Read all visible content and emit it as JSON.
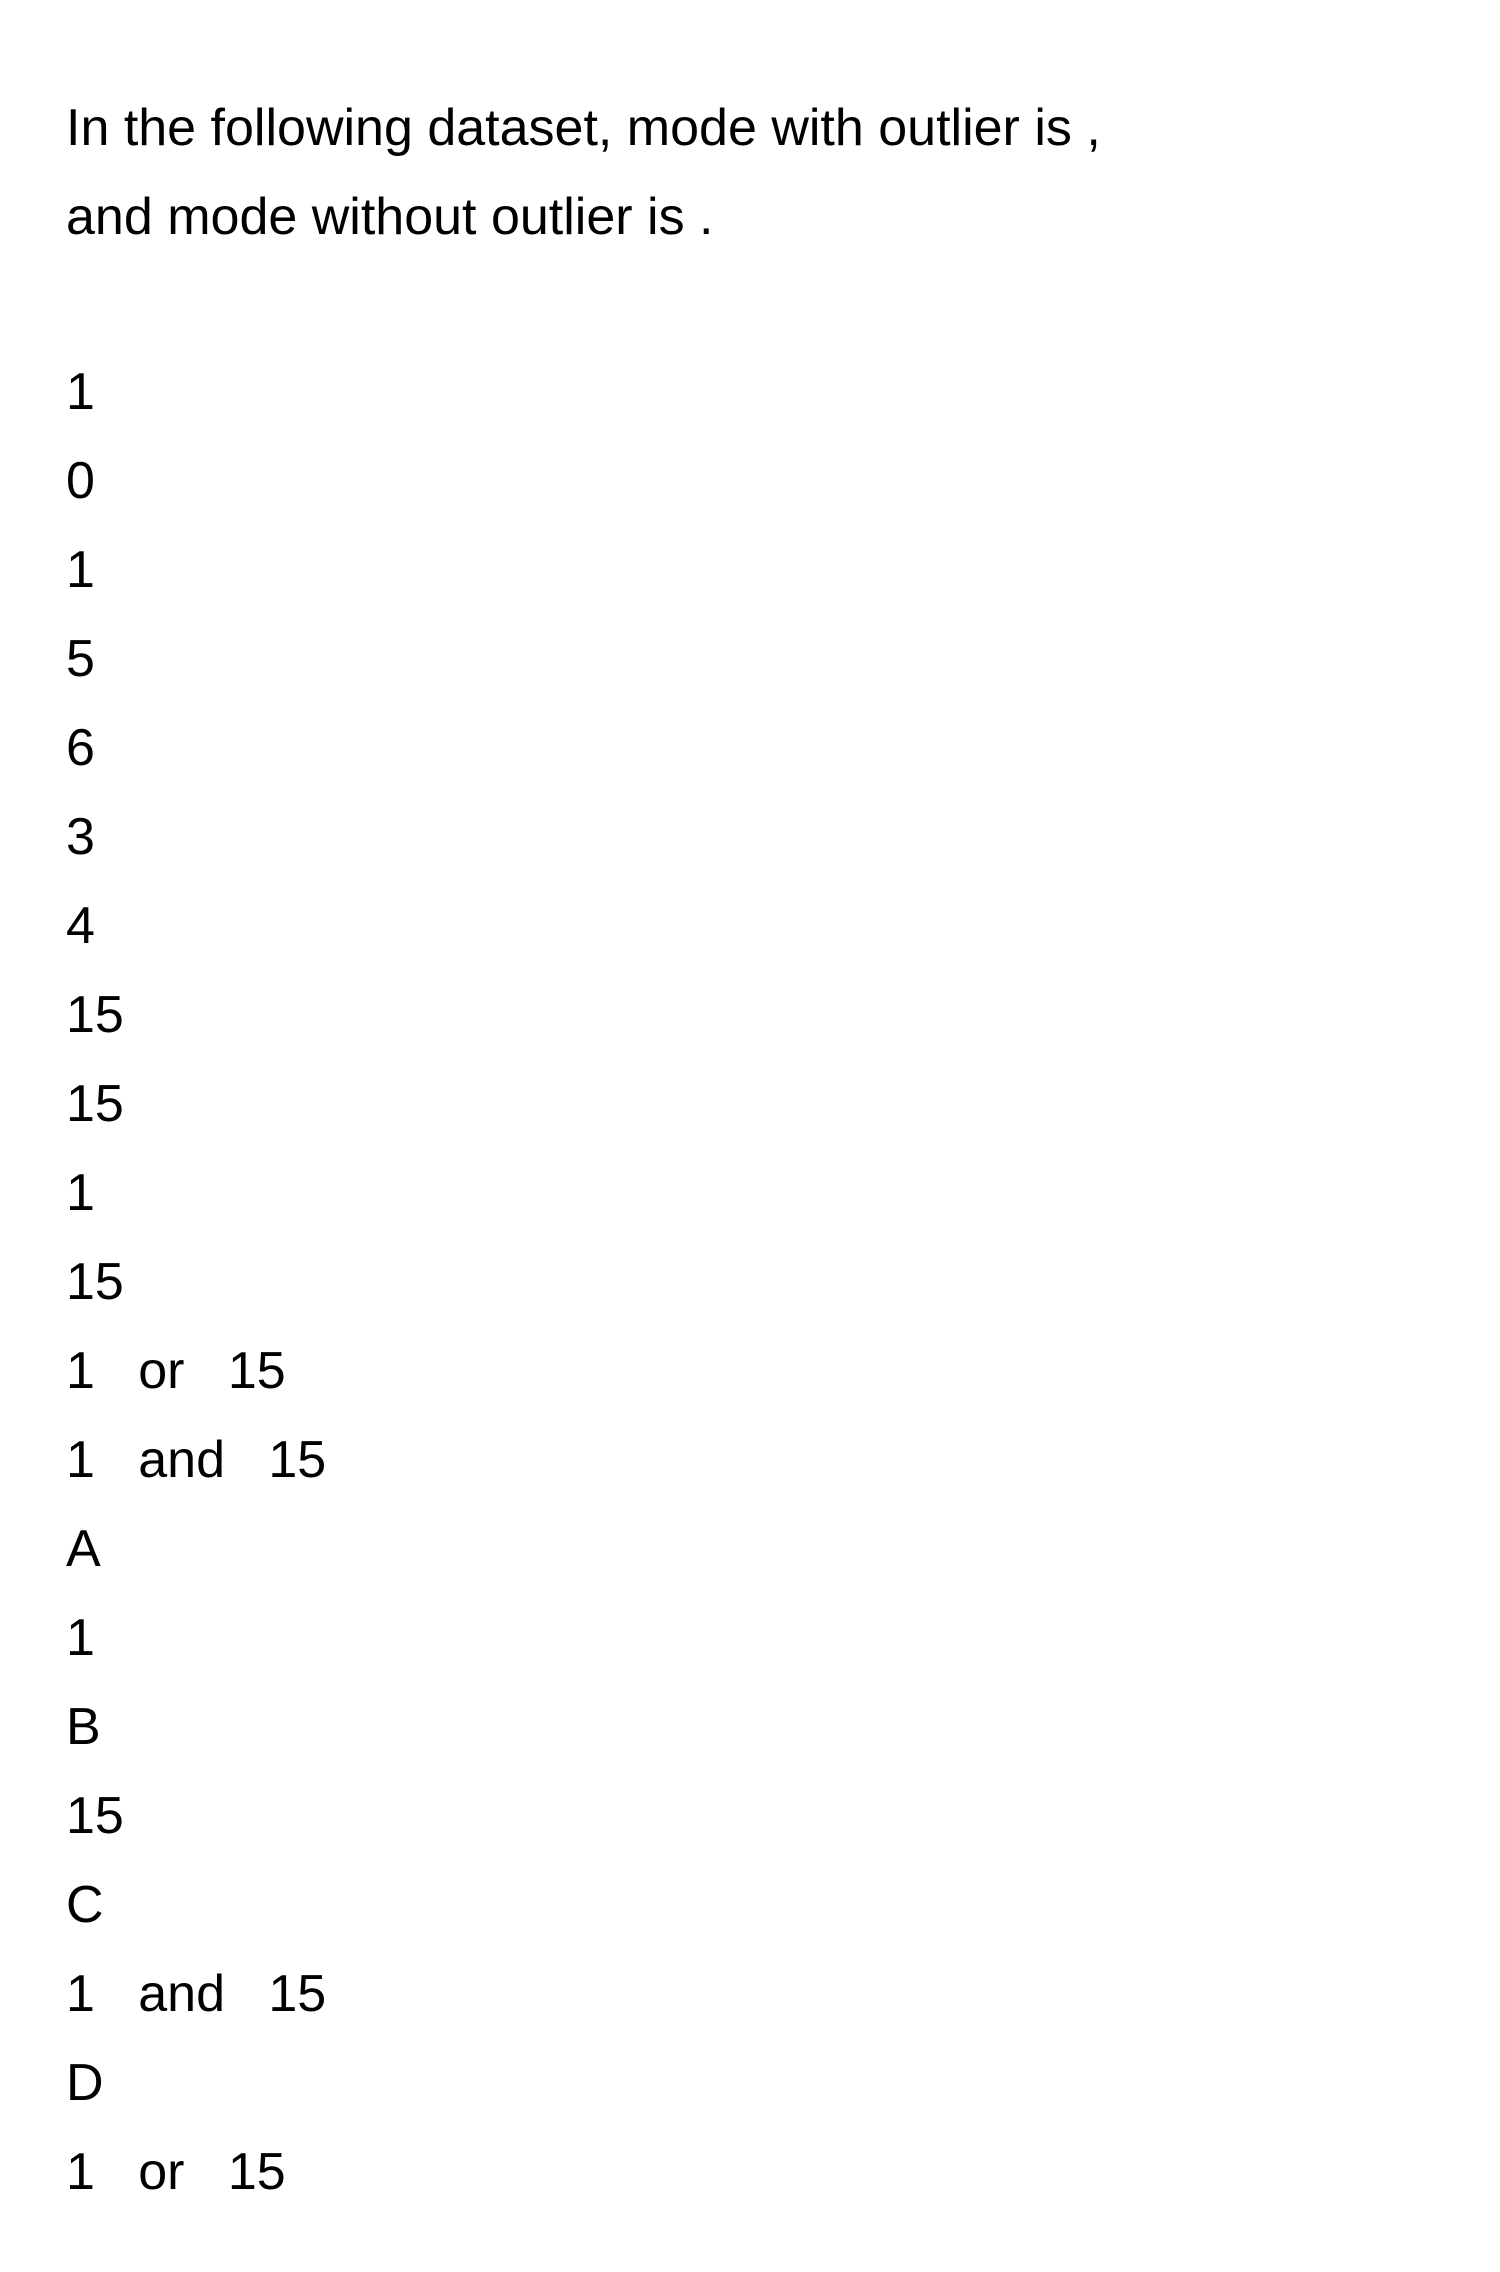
{
  "question": {
    "line1": "In the following dataset, mode with outlier is ,",
    "line2": "and mode without outlier is ."
  },
  "lines": [
    "1",
    "0",
    "1",
    "5",
    "6",
    "3",
    "4",
    "15",
    "15",
    "1",
    "15",
    "1   or   15",
    "1   and   15",
    "A",
    "1",
    "B",
    "15",
    "C",
    "1   and   15",
    "D",
    "1   or   15"
  ]
}
